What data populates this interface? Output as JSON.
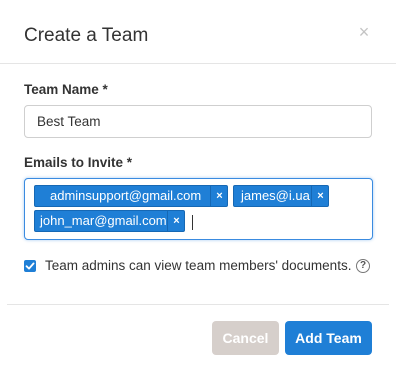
{
  "dialog": {
    "title": "Create a Team",
    "close_glyph": "×"
  },
  "form": {
    "team_name_label": "Team Name *",
    "team_name_value": "Best Team",
    "emails_label": "Emails to Invite *",
    "emails": [
      {
        "label": "adminsupport@gmail.com",
        "remove_glyph": "×"
      },
      {
        "label": "james@i.ua",
        "remove_glyph": "×"
      },
      {
        "label": "john_mar@gmail.com",
        "remove_glyph": "×"
      }
    ],
    "checkbox_label": "Team admins can view team members' documents.",
    "checkbox_checked": true,
    "help_glyph": "?"
  },
  "footer": {
    "cancel_label": "Cancel",
    "add_label": "Add Team"
  },
  "colors": {
    "primary": "#1f7fd6",
    "cancel_disabled": "#d6cfcb",
    "focus_border": "#3a8be0"
  }
}
